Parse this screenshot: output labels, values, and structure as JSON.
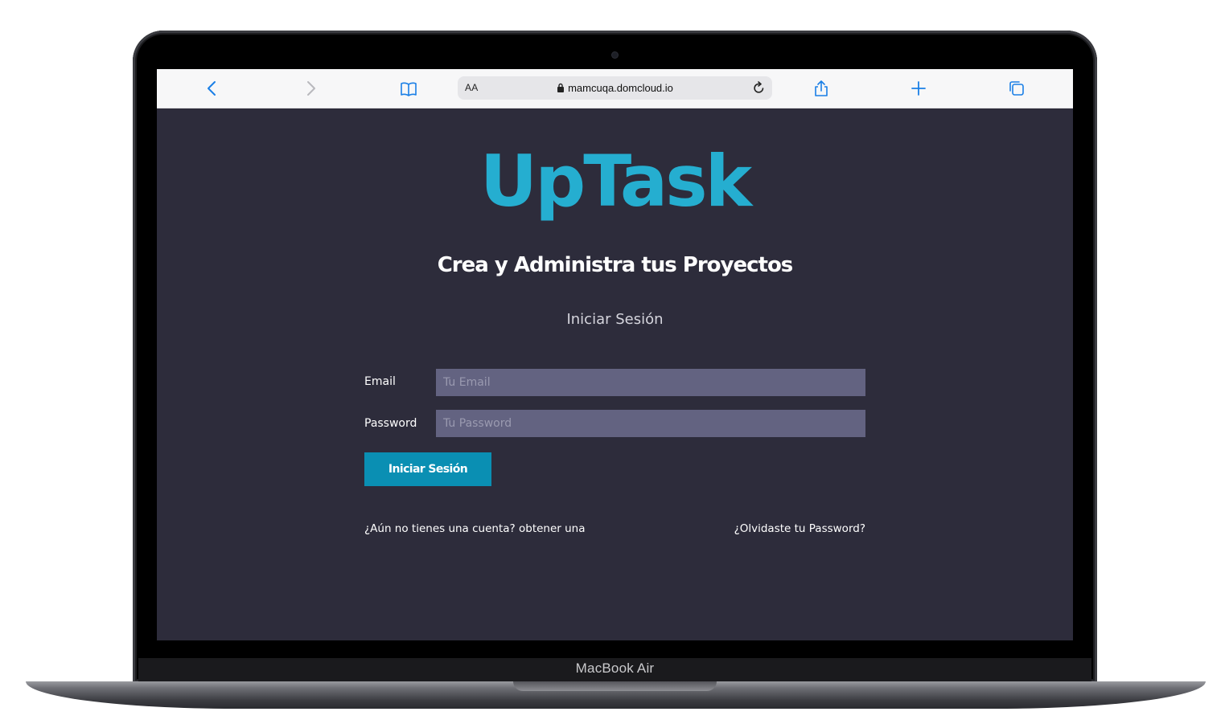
{
  "device": {
    "label": "MacBook Air"
  },
  "browser": {
    "reader_mode_label": "AA",
    "url": "mamcuqa.domcloud.io",
    "icons": {
      "back": "chevron-left-icon",
      "forward": "chevron-right-icon",
      "bookmarks": "book-icon",
      "lock": "lock-icon",
      "reload": "reload-icon",
      "share": "share-icon",
      "new_tab": "plus-icon",
      "tabs": "tabs-icon"
    },
    "accent_color": "#1a7fe6"
  },
  "page": {
    "logo": "UpTask",
    "logo_color": "#25aed0",
    "tagline": "Crea y Administra tus Proyectos",
    "form_title": "Iniciar Sesión",
    "email_label": "Email",
    "email_placeholder": "Tu Email",
    "email_value": "",
    "password_label": "Password",
    "password_placeholder": "Tu Password",
    "password_value": "",
    "submit_label": "Iniciar Sesión",
    "signup_link": "¿Aún no tienes una cuenta? obtener una",
    "forgot_link": "¿Olvidaste tu Password?",
    "background_color": "#2d2c3b",
    "button_color": "#0a8fb3"
  }
}
